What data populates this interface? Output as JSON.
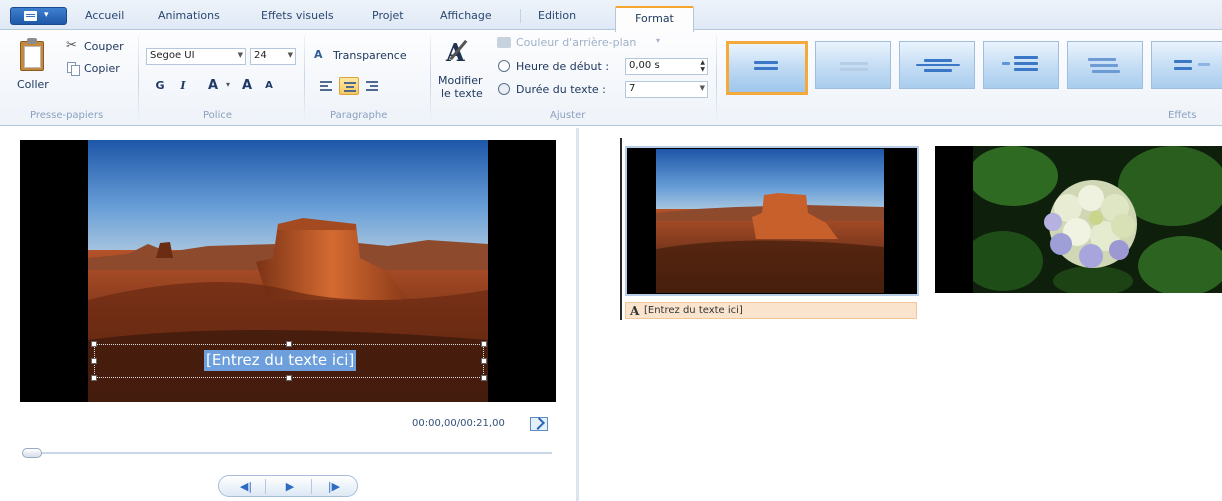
{
  "tabs": [
    {
      "label": "Accueil",
      "active": false
    },
    {
      "label": "Animations",
      "active": false
    },
    {
      "label": "Effets visuels",
      "active": false
    },
    {
      "label": "Projet",
      "active": false
    },
    {
      "label": "Affichage",
      "active": false
    },
    {
      "label": "Edition",
      "active": false
    },
    {
      "label": "Format",
      "active": true
    }
  ],
  "clipboard": {
    "paste_label": "Coller",
    "cut_label": "Couper",
    "copy_label": "Copier",
    "group_label": "Presse-papiers"
  },
  "font": {
    "family": "Segoe UI",
    "size": "24",
    "bold": "G",
    "italic": "I",
    "color_glyph": "A",
    "grow": "A",
    "shrink": "A",
    "group_label": "Police"
  },
  "paragraph": {
    "transparency_label": "Transparence",
    "group_label": "Paragraphe",
    "alignment": "center"
  },
  "adjust": {
    "edit_text_label_line1": "Modifier",
    "edit_text_label_line2": "le texte",
    "background_color_label": "Couleur d'arrière-plan",
    "start_time_label": "Heure de début :",
    "start_time_value": "0,00 s",
    "duration_label": "Durée du texte :",
    "duration_value": "7",
    "group_label": "Ajuster"
  },
  "effects": {
    "group_label": "Effets",
    "selected_index": 0,
    "items": [
      "none-effect-icon",
      "fade-effect-icon",
      "fly-in-effect-icon",
      "zoom-effect-icon",
      "scroll-effect-icon",
      "slide-effect-icon"
    ]
  },
  "preview": {
    "overlay_text": "[Entrez du texte ici]",
    "timecode": "00:00,00/00:21,00",
    "position_fraction": 0
  },
  "storyboard": {
    "caption_text": "[Entrez du texte ici]",
    "clips": [
      {
        "name": "desert-clip",
        "selected": true
      },
      {
        "name": "flower-clip",
        "selected": false
      }
    ]
  }
}
